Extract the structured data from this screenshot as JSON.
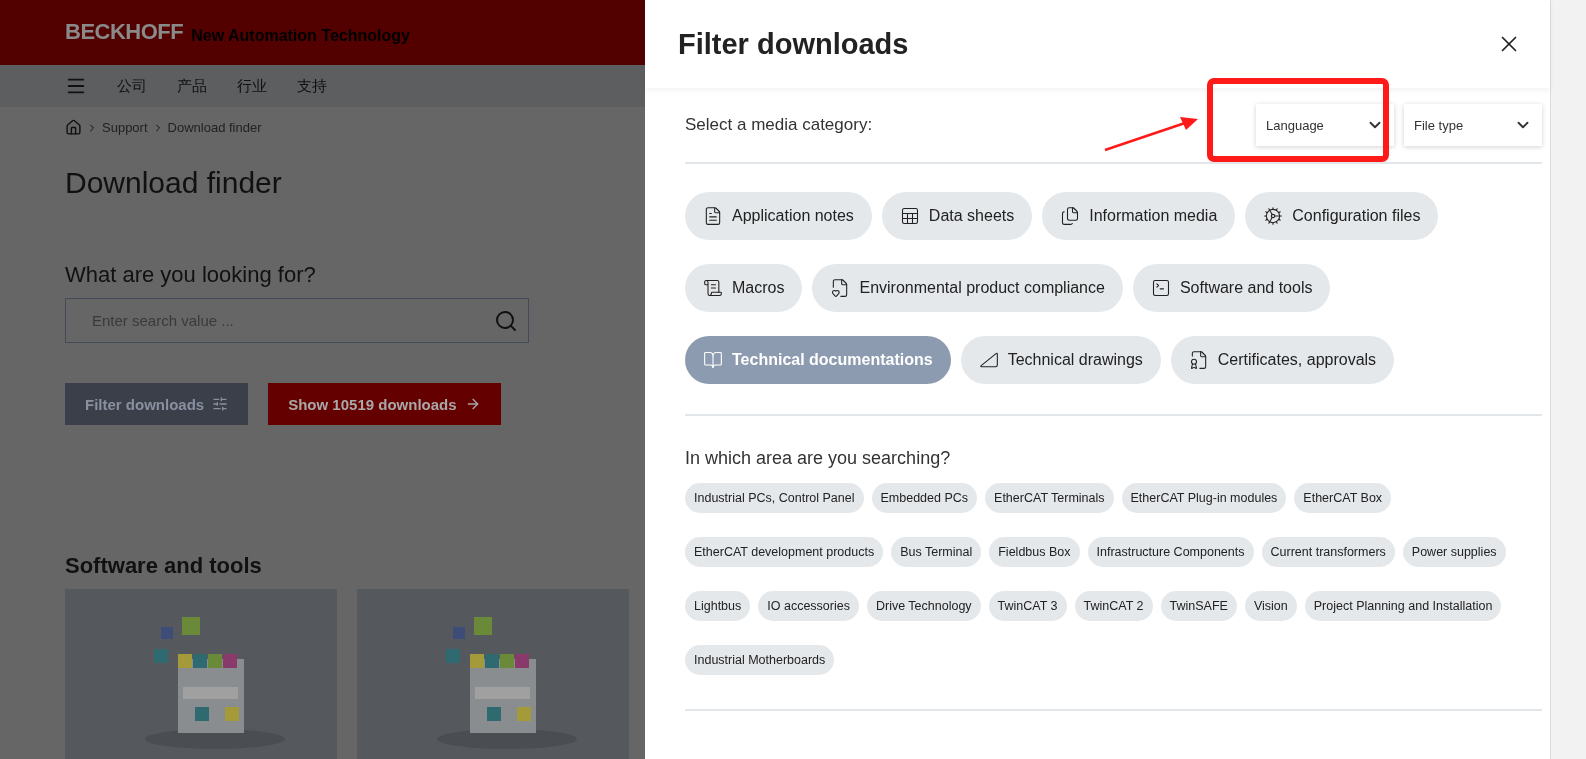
{
  "header": {
    "brand": "BECKHOFF",
    "tagline": "New Automation Technology"
  },
  "nav": {
    "items": [
      "公司",
      "产品",
      "行业",
      "支持"
    ]
  },
  "breadcrumb": [
    "Support",
    "Download finder"
  ],
  "page_title": "Download finder",
  "search": {
    "label": "What are you looking for?",
    "placeholder": "Enter search value ..."
  },
  "buttons": [
    {
      "kind": "filter",
      "label": "Filter downloads"
    },
    {
      "kind": "show",
      "label": "Show 10519 downloads"
    }
  ],
  "section": {
    "title": "Software and tools"
  },
  "drawer": {
    "title": "Filter downloads",
    "category_label": "Select a media category:",
    "dropdowns": [
      "Language",
      "File type"
    ],
    "categories": [
      {
        "label": "Application notes",
        "selected": false
      },
      {
        "label": "Data sheets",
        "selected": false
      },
      {
        "label": "Information media",
        "selected": false
      },
      {
        "label": "Configuration files",
        "selected": false
      },
      {
        "label": "Macros",
        "selected": false
      },
      {
        "label": "Environmental product compliance",
        "selected": false
      },
      {
        "label": "Software and tools",
        "selected": false
      },
      {
        "label": "Technical documentations",
        "selected": true
      },
      {
        "label": "Technical drawings",
        "selected": false
      },
      {
        "label": "Certificates, approvals",
        "selected": false
      }
    ],
    "area_heading": "In which area are you searching?",
    "areas": [
      "Industrial PCs, Control Panel",
      "Embedded PCs",
      "EtherCAT Terminals",
      "EtherCAT Plug-in modules",
      "EtherCAT Box",
      "EtherCAT development products",
      "Bus Terminal",
      "Fieldbus Box",
      "Infrastructure Components",
      "Current transformers",
      "Power supplies",
      "Lightbus",
      "IO accessories",
      "Drive Technology",
      "TwinCAT 3",
      "TwinCAT 2",
      "TwinSAFE",
      "Vision",
      "Project Planning and Installation",
      "Industrial Motherboards"
    ]
  }
}
